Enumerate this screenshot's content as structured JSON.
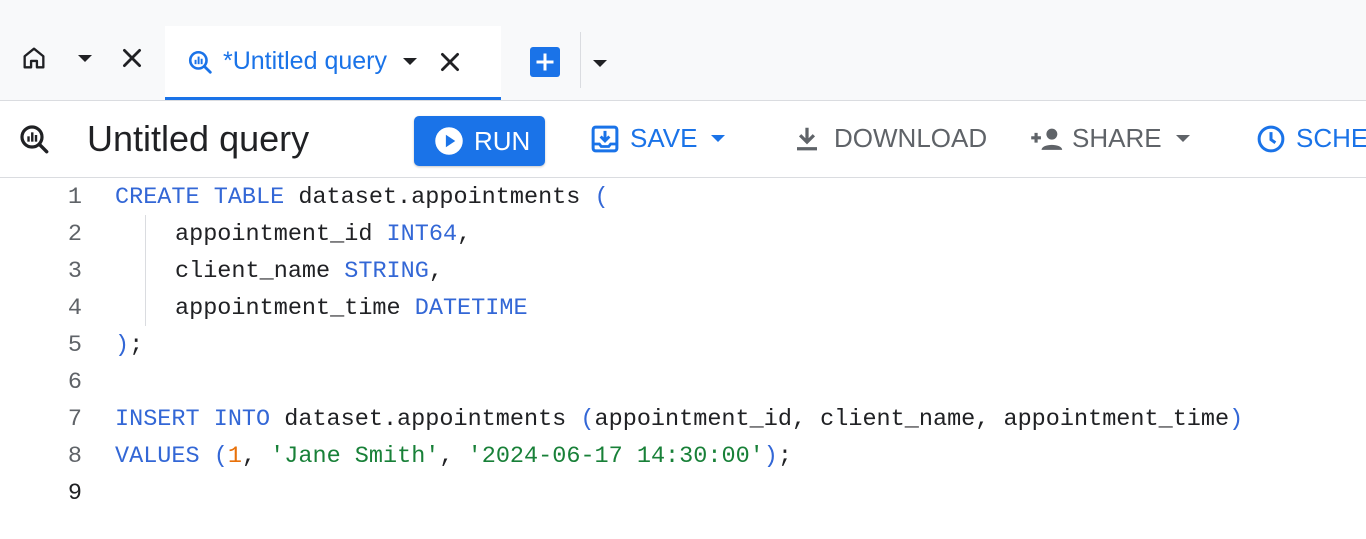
{
  "tabs": {
    "home": {
      "icon": "home-icon"
    },
    "query_tab": {
      "label": "*Untitled query",
      "icon": "query-icon"
    }
  },
  "toolbar": {
    "title": "Untitled query",
    "run_label": "RUN",
    "save_label": "SAVE",
    "download_label": "DOWNLOAD",
    "share_label": "SHARE",
    "schedule_label": "SCHE"
  },
  "editor": {
    "active_line": 9,
    "lines": [
      {
        "num": "1",
        "tokens": [
          {
            "t": "CREATE TABLE",
            "c": "kw"
          },
          {
            "t": " dataset.appointments ",
            "c": "id"
          },
          {
            "t": "(",
            "c": "pn"
          }
        ]
      },
      {
        "num": "2",
        "tokens": [
          {
            "t": "appointment_id ",
            "c": "id"
          },
          {
            "t": "INT64",
            "c": "kw"
          },
          {
            "t": ",",
            "c": "id"
          }
        ]
      },
      {
        "num": "3",
        "tokens": [
          {
            "t": "client_name ",
            "c": "id"
          },
          {
            "t": "STRING",
            "c": "kw"
          },
          {
            "t": ",",
            "c": "id"
          }
        ]
      },
      {
        "num": "4",
        "tokens": [
          {
            "t": "appointment_time ",
            "c": "id"
          },
          {
            "t": "DATETIME",
            "c": "kw"
          }
        ]
      },
      {
        "num": "5",
        "tokens": [
          {
            "t": ")",
            "c": "pn"
          },
          {
            "t": ";",
            "c": "id"
          }
        ]
      },
      {
        "num": "6",
        "tokens": []
      },
      {
        "num": "7",
        "tokens": [
          {
            "t": "INSERT INTO",
            "c": "kw"
          },
          {
            "t": " dataset.appointments ",
            "c": "id"
          },
          {
            "t": "(",
            "c": "pn"
          },
          {
            "t": "appointment_id, client_name, appointment_time",
            "c": "id"
          },
          {
            "t": ")",
            "c": "pn"
          }
        ]
      },
      {
        "num": "8",
        "tokens": [
          {
            "t": "VALUES",
            "c": "kw"
          },
          {
            "t": " ",
            "c": "id"
          },
          {
            "t": "(",
            "c": "pn"
          },
          {
            "t": "1",
            "c": "num"
          },
          {
            "t": ", ",
            "c": "id"
          },
          {
            "t": "'Jane Smith'",
            "c": "str"
          },
          {
            "t": ", ",
            "c": "id"
          },
          {
            "t": "'2024-06-17 14:30:00'",
            "c": "str"
          },
          {
            "t": ")",
            "c": "pn"
          },
          {
            "t": ";",
            "c": "id"
          }
        ]
      },
      {
        "num": "9",
        "tokens": []
      }
    ]
  },
  "colors": {
    "accent": "#1a73e8",
    "keyword": "#3367d6",
    "string": "#188038",
    "number": "#e8710a"
  }
}
